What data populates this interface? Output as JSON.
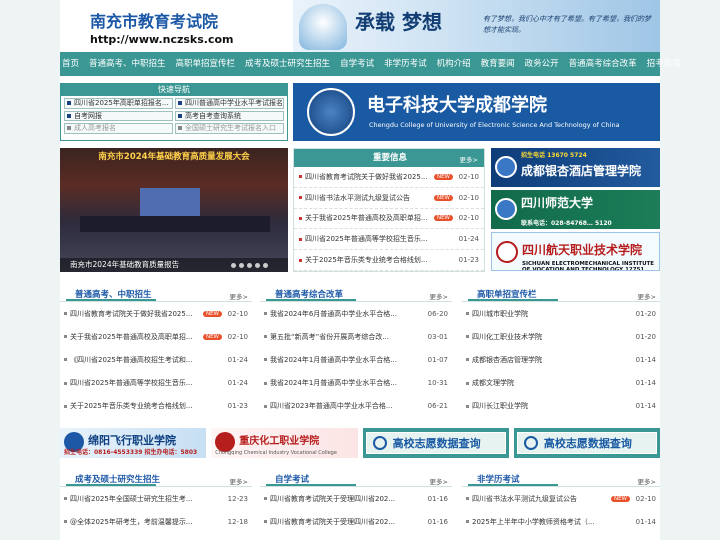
{
  "header": {
    "logo_title": "南充市教育考试院",
    "logo_url": "http://www.nczsks.com",
    "banner_main": "承载 梦想",
    "banner_sub": "有了梦想，我们心中才有了希望。有了希望，我们的梦想才能实现。"
  },
  "nav": {
    "items": [
      "首页",
      "普通高考、中职招生",
      "高职单招宣传栏",
      "成考及硕士研究生招生",
      "自学考试",
      "非学历考试",
      "机构介绍",
      "教育要闻",
      "政务公开",
      "普通高考综合改革",
      "招考新闻"
    ]
  },
  "quick_nav": {
    "title": "快速导航",
    "items": [
      {
        "label": "四川省2025年高职单招报名..."
      },
      {
        "label": "四川普通高中学业水平考试报名..."
      },
      {
        "label": "自考网报"
      },
      {
        "label": "高考自考查询系统"
      },
      {
        "label": "成人高考报名"
      },
      {
        "label": "全国硕士研究生考试报名入口"
      }
    ]
  },
  "college_banner": {
    "name": "电子科技大学成都学院",
    "en": "Chengdu College of University of Electronic Science And Technology of China"
  },
  "slide": {
    "banner": "南充市2024年基础教育高质量发展大会",
    "caption": "南充市2024年基础教育质量报告"
  },
  "important_news": {
    "title": "重要信息",
    "more": "更多>",
    "items": [
      {
        "text": "四川省教育考试院关于做好我省2025...",
        "new": true,
        "date": "02-10"
      },
      {
        "text": "四川省书法水平测试九级复试公告",
        "new": true,
        "date": "02-10"
      },
      {
        "text": "关于我省2025年普通高校及高职单招...",
        "new": true,
        "date": "02-10"
      },
      {
        "text": "四川省2025年普通高等学校招生音乐...",
        "new": false,
        "date": "01-24"
      },
      {
        "text": "关于2025年音乐类专业统考合格线划...",
        "new": false,
        "date": "01-23"
      }
    ]
  },
  "side_ads": [
    {
      "name": "成都银杏酒店管理学院",
      "phone": "招生电话 13670   5724"
    },
    {
      "name": "四川师范大学",
      "phone": "联系电话：028-84768…  5120"
    },
    {
      "name": "四川航天职业技术学院",
      "phone": "SICHUAN ELECTROMECHANICAL INSTITUTE OF VOCATION AND TECHNOLOGY  12751  5154"
    }
  ],
  "panels": [
    {
      "title": "普通高考、中职招生",
      "more": "更多>",
      "items": [
        {
          "text": "四川省教育考试院关于做好我省2025...",
          "new": true,
          "date": "02-10"
        },
        {
          "text": "关于我省2025年普通高校及高职单招...",
          "new": true,
          "date": "02-10"
        },
        {
          "text": "《四川省2025年普通高校招生考试和...",
          "new": false,
          "date": "01-24"
        },
        {
          "text": "四川省2025年普通高等学校招生音乐...",
          "new": false,
          "date": "01-24"
        },
        {
          "text": "关于2025年音乐类专业统考合格线划...",
          "new": false,
          "date": "01-23"
        }
      ]
    },
    {
      "title": "普通高考综合改革",
      "more": "更多>",
      "items": [
        {
          "text": "我省2024年6月普通高中学业水平合格...",
          "new": false,
          "date": "06-20"
        },
        {
          "text": "第五批“新高考”省份开展高考综合改...",
          "new": false,
          "date": "03-01"
        },
        {
          "text": "我省2024年1月普通高中学业水平合格...",
          "new": false,
          "date": "01-07"
        },
        {
          "text": "我省2024年1月普通高中学业水平合格...",
          "new": false,
          "date": "10-31"
        },
        {
          "text": "四川省2023年普通高中学业水平合格...",
          "new": false,
          "date": "06-21"
        }
      ]
    },
    {
      "title": "高职单招宣传栏",
      "more": "更多>",
      "items": [
        {
          "text": "四川城市职业学院",
          "new": false,
          "date": "01-20"
        },
        {
          "text": "四川化工职业技术学院",
          "new": false,
          "date": "01-20"
        },
        {
          "text": "成都银杏酒店管理学院",
          "new": false,
          "date": "01-14"
        },
        {
          "text": "成都文理学院",
          "new": false,
          "date": "01-14"
        },
        {
          "text": "四川长江职业学院",
          "new": false,
          "date": "01-14"
        }
      ]
    }
  ],
  "strip_ads": [
    {
      "name": "绵阳飞行职业学院",
      "phone": "招生电话：0816-4553339  招生办电话：5803"
    },
    {
      "name": "重庆化工职业学院",
      "phone": "Chongqing Chemical Industry Vocational College"
    },
    {
      "label": "高校志愿数据查询"
    },
    {
      "label": "高校志愿数据查询"
    }
  ],
  "bottom_panels": [
    {
      "title": "成考及硕士研究生招生",
      "more": "更多>",
      "items": [
        {
          "text": "四川省2025年全国硕士研究生招生考...",
          "new": false,
          "date": "12-23"
        },
        {
          "text": "@全体2025年研考生，考前温馨提示...",
          "new": false,
          "date": "12-18"
        }
      ]
    },
    {
      "title": "自学考试",
      "more": "更多>",
      "items": [
        {
          "text": "四川省教育考试院关于受理四川省202...",
          "new": false,
          "date": "01-16"
        },
        {
          "text": "四川省教育考试院关于受理四川省202...",
          "new": false,
          "date": "01-16"
        }
      ]
    },
    {
      "title": "非学历考试",
      "more": "更多>",
      "items": [
        {
          "text": "四川省书法水平测试九级复试公告",
          "new": true,
          "date": "02-10"
        },
        {
          "text": "2025年上半年中小学教师资格考试（...",
          "new": false,
          "date": "01-14"
        }
      ]
    }
  ]
}
